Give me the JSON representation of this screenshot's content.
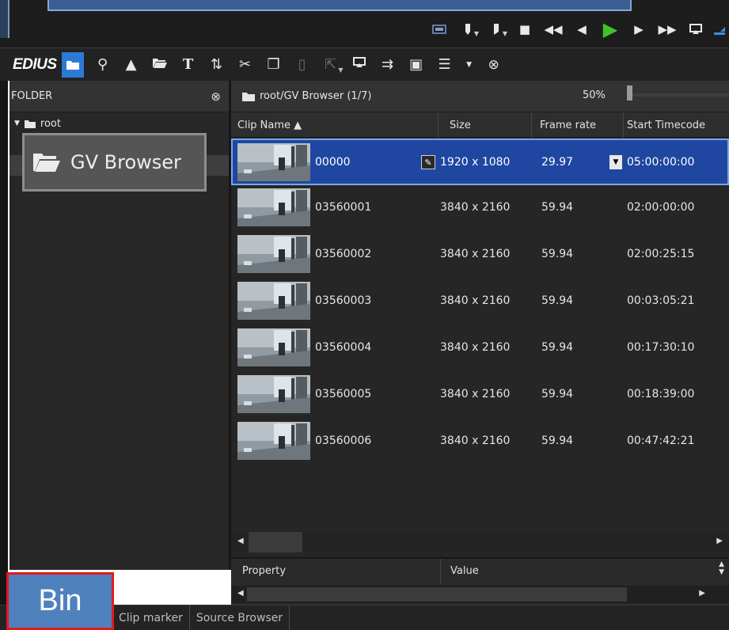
{
  "app": {
    "logo": "EDIUS"
  },
  "colors": {
    "selection": "#1f47a1",
    "toolbar_active": "#2b7ad6",
    "play_green": "#41c22b",
    "annotation_fill": "#4f81bd",
    "annotation_border": "#e31a1a"
  },
  "player_controls": [
    {
      "name": "tape-icon"
    },
    {
      "name": "set-in-icon",
      "dropdown": true
    },
    {
      "name": "set-out-icon",
      "dropdown": true
    },
    {
      "name": "stop-icon"
    },
    {
      "name": "rewind-icon"
    },
    {
      "name": "previous-frame-icon"
    },
    {
      "name": "play-icon"
    },
    {
      "name": "next-frame-icon"
    },
    {
      "name": "fast-forward-icon"
    },
    {
      "name": "loop-icon"
    },
    {
      "name": "insert-to-timeline-icon"
    }
  ],
  "toolbar": {
    "items": [
      "folder-icon",
      "search-icon",
      "up-icon",
      "open-folder-icon",
      "add-title-icon",
      "add-clip-icon",
      "cut-icon",
      "copy-icon",
      "paste-icon",
      "export-icon",
      "add-to-timeline-icon",
      "add-dropdown-icon",
      "overwrite-icon",
      "list-view-icon",
      "close-icon"
    ]
  },
  "folder_panel": {
    "title": "FOLDER",
    "root_label": "root",
    "selected_folder": "GV Browser"
  },
  "clip_panel": {
    "path": "root/GV Browser (1/7)",
    "zoom": "50%",
    "zoom_level": 0.0,
    "columns": {
      "name": "Clip Name ▲",
      "size": "Size",
      "frame_rate": "Frame rate",
      "start_tc": "Start Timecode"
    },
    "clips": [
      {
        "name": "00000",
        "size": "1920 x 1080",
        "frame_rate": "29.97",
        "start_tc": "05:00:00:00",
        "selected": true
      },
      {
        "name": "03560001",
        "size": "3840 x 2160",
        "frame_rate": "59.94",
        "start_tc": "02:00:00:00"
      },
      {
        "name": "03560002",
        "size": "3840 x 2160",
        "frame_rate": "59.94",
        "start_tc": "02:00:25:15"
      },
      {
        "name": "03560003",
        "size": "3840 x 2160",
        "frame_rate": "59.94",
        "start_tc": "00:03:05:21"
      },
      {
        "name": "03560004",
        "size": "3840 x 2160",
        "frame_rate": "59.94",
        "start_tc": "00:17:30:10"
      },
      {
        "name": "03560005",
        "size": "3840 x 2160",
        "frame_rate": "59.94",
        "start_tc": "00:18:39:00"
      },
      {
        "name": "03560006",
        "size": "3840 x 2160",
        "frame_rate": "59.94",
        "start_tc": "00:47:42:21"
      }
    ]
  },
  "property_panel": {
    "col_property": "Property",
    "col_value": "Value"
  },
  "tabs": [
    "Clip marker",
    "Source Browser"
  ],
  "annotation": {
    "label": "Bin"
  }
}
